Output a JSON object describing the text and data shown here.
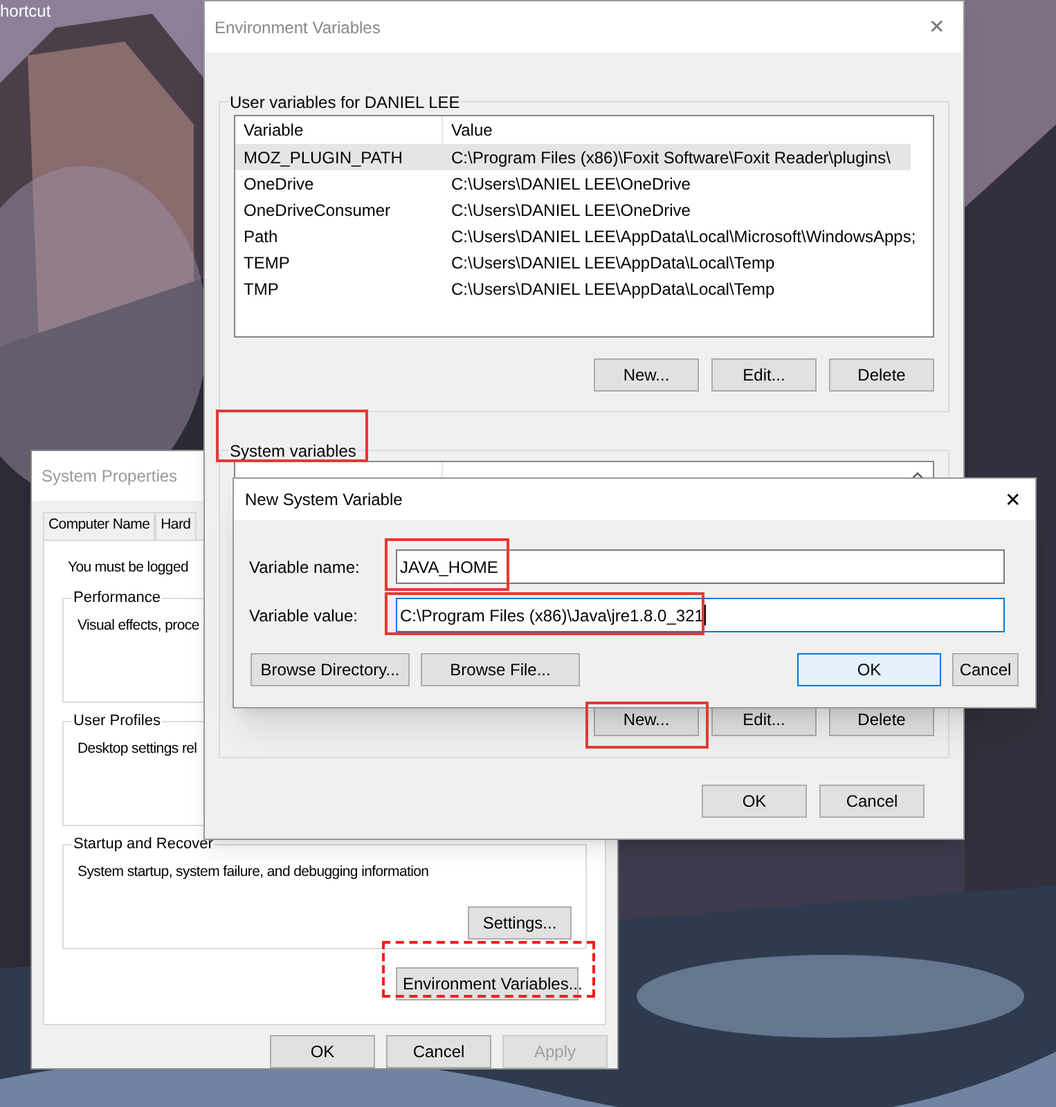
{
  "desktop": {
    "shortcut_label": "hortcut"
  },
  "system_properties": {
    "title": "System Properties",
    "tabs": [
      {
        "label": "Computer Name"
      },
      {
        "label": "Hard"
      }
    ],
    "notice": "You must be logged",
    "groups": [
      {
        "title": "Performance",
        "text": "Visual effects, proce"
      },
      {
        "title": "User Profiles",
        "text": "Desktop settings rel"
      },
      {
        "title": "Startup and Recover",
        "text": "System startup, system failure, and debugging information",
        "button": "Settings..."
      }
    ],
    "env_button": "Environment Variables...",
    "buttons": [
      {
        "label": "OK",
        "disabled": false
      },
      {
        "label": "Cancel",
        "disabled": false
      },
      {
        "label": "Apply",
        "disabled": true
      }
    ]
  },
  "environment_variables": {
    "title": "Environment Variables",
    "close": "✕",
    "user_section": {
      "title": "User variables for DANIEL LEE",
      "columns": [
        "Variable",
        "Value"
      ],
      "rows": [
        {
          "variable": "MOZ_PLUGIN_PATH",
          "value": "C:\\Program Files (x86)\\Foxit Software\\Foxit Reader\\plugins\\",
          "selected": true
        },
        {
          "variable": "OneDrive",
          "value": "C:\\Users\\DANIEL LEE\\OneDrive",
          "selected": false
        },
        {
          "variable": "OneDriveConsumer",
          "value": "C:\\Users\\DANIEL LEE\\OneDrive",
          "selected": false
        },
        {
          "variable": "Path",
          "value": "C:\\Users\\DANIEL LEE\\AppData\\Local\\Microsoft\\WindowsApps;",
          "selected": false
        },
        {
          "variable": "TEMP",
          "value": "C:\\Users\\DANIEL LEE\\AppData\\Local\\Temp",
          "selected": false
        },
        {
          "variable": "TMP",
          "value": "C:\\Users\\DANIEL LEE\\AppData\\Local\\Temp",
          "selected": false
        }
      ],
      "buttons": [
        "New...",
        "Edit...",
        "Delete"
      ]
    },
    "system_section": {
      "title": "System variables",
      "buttons": [
        "New...",
        "Edit...",
        "Delete"
      ]
    },
    "buttons": [
      "OK",
      "Cancel"
    ]
  },
  "new_system_variable": {
    "title": "New System Variable",
    "close": "✕",
    "fields": [
      {
        "label": "Variable name:",
        "value": "JAVA_HOME",
        "focused": false
      },
      {
        "label": "Variable value:",
        "value": "C:\\Program Files (x86)\\Java\\jre1.8.0_321",
        "focused": true
      }
    ],
    "buttons": [
      {
        "label": "Browse Directory...",
        "default": false
      },
      {
        "label": "Browse File...",
        "default": false
      },
      {
        "label": "OK",
        "default": true
      },
      {
        "label": "Cancel",
        "default": false
      }
    ]
  }
}
